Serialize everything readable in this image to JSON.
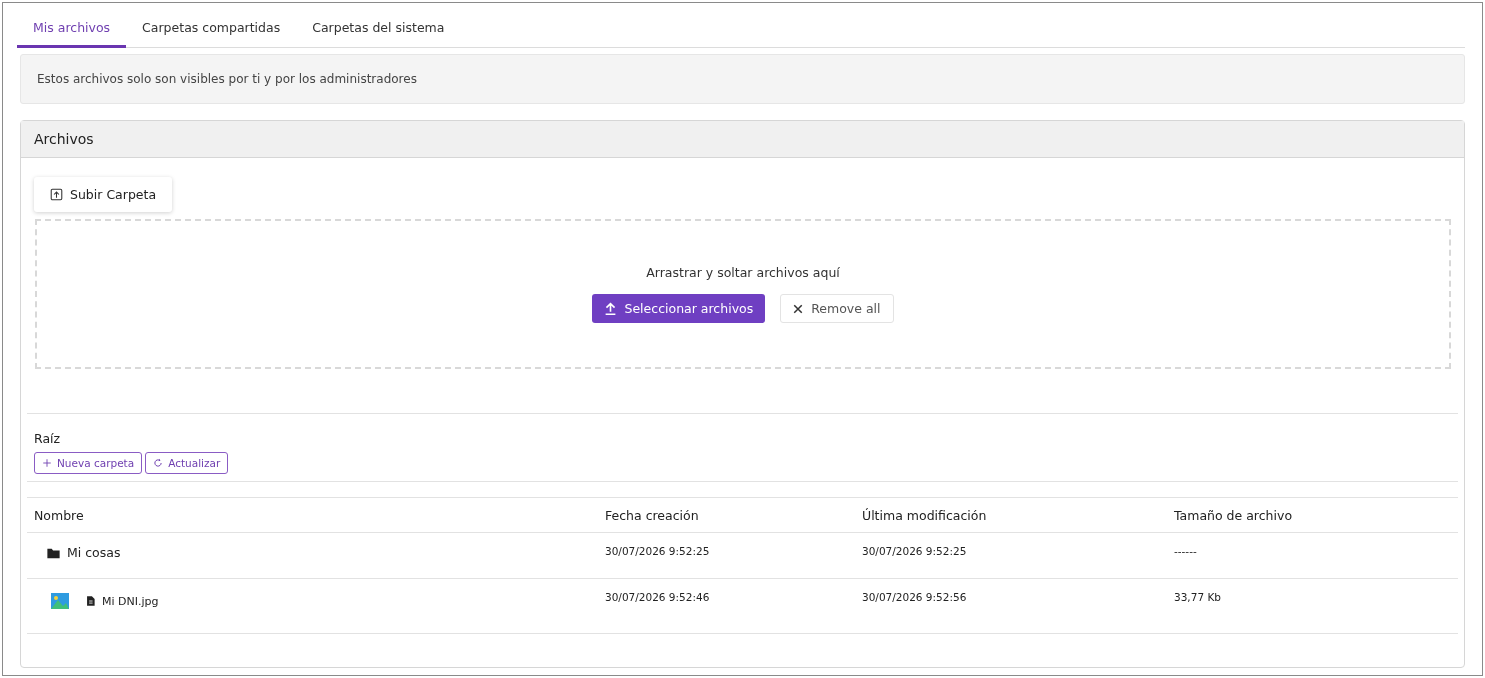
{
  "tabs": [
    {
      "label": "Mis archivos",
      "selected": true
    },
    {
      "label": "Carpetas compartidas",
      "selected": false
    },
    {
      "label": "Carpetas del sistema",
      "selected": false
    }
  ],
  "notice": "Estos archivos solo son visibles por ti y por los administradores",
  "card": {
    "title": "Archivos",
    "upload_folder_button": "Subir Carpeta",
    "dropzone": {
      "hint": "Arrastrar y soltar archivos aquí",
      "select_button": "Seleccionar archivos",
      "remove_button": "Remove all"
    },
    "breadcrumb": "Raíz",
    "actions": [
      {
        "kind": "add",
        "label": "Nueva carpeta"
      },
      {
        "kind": "refresh",
        "label": "Actualizar"
      }
    ],
    "table": {
      "columns": [
        "Nombre",
        "Fecha creación",
        "Última modificación",
        "Tamaño de archivo"
      ],
      "rows": [
        {
          "kind": "folder",
          "name": "Mi cosas",
          "created": "30/07/2026 9:52:25",
          "modified": "30/07/2026 9:52:25",
          "size": "------"
        },
        {
          "kind": "file",
          "name": "Mi DNI.jpg",
          "created": "30/07/2026 9:52:46",
          "modified": "30/07/2026 9:52:56",
          "size": "33,77 Kb"
        }
      ]
    }
  }
}
